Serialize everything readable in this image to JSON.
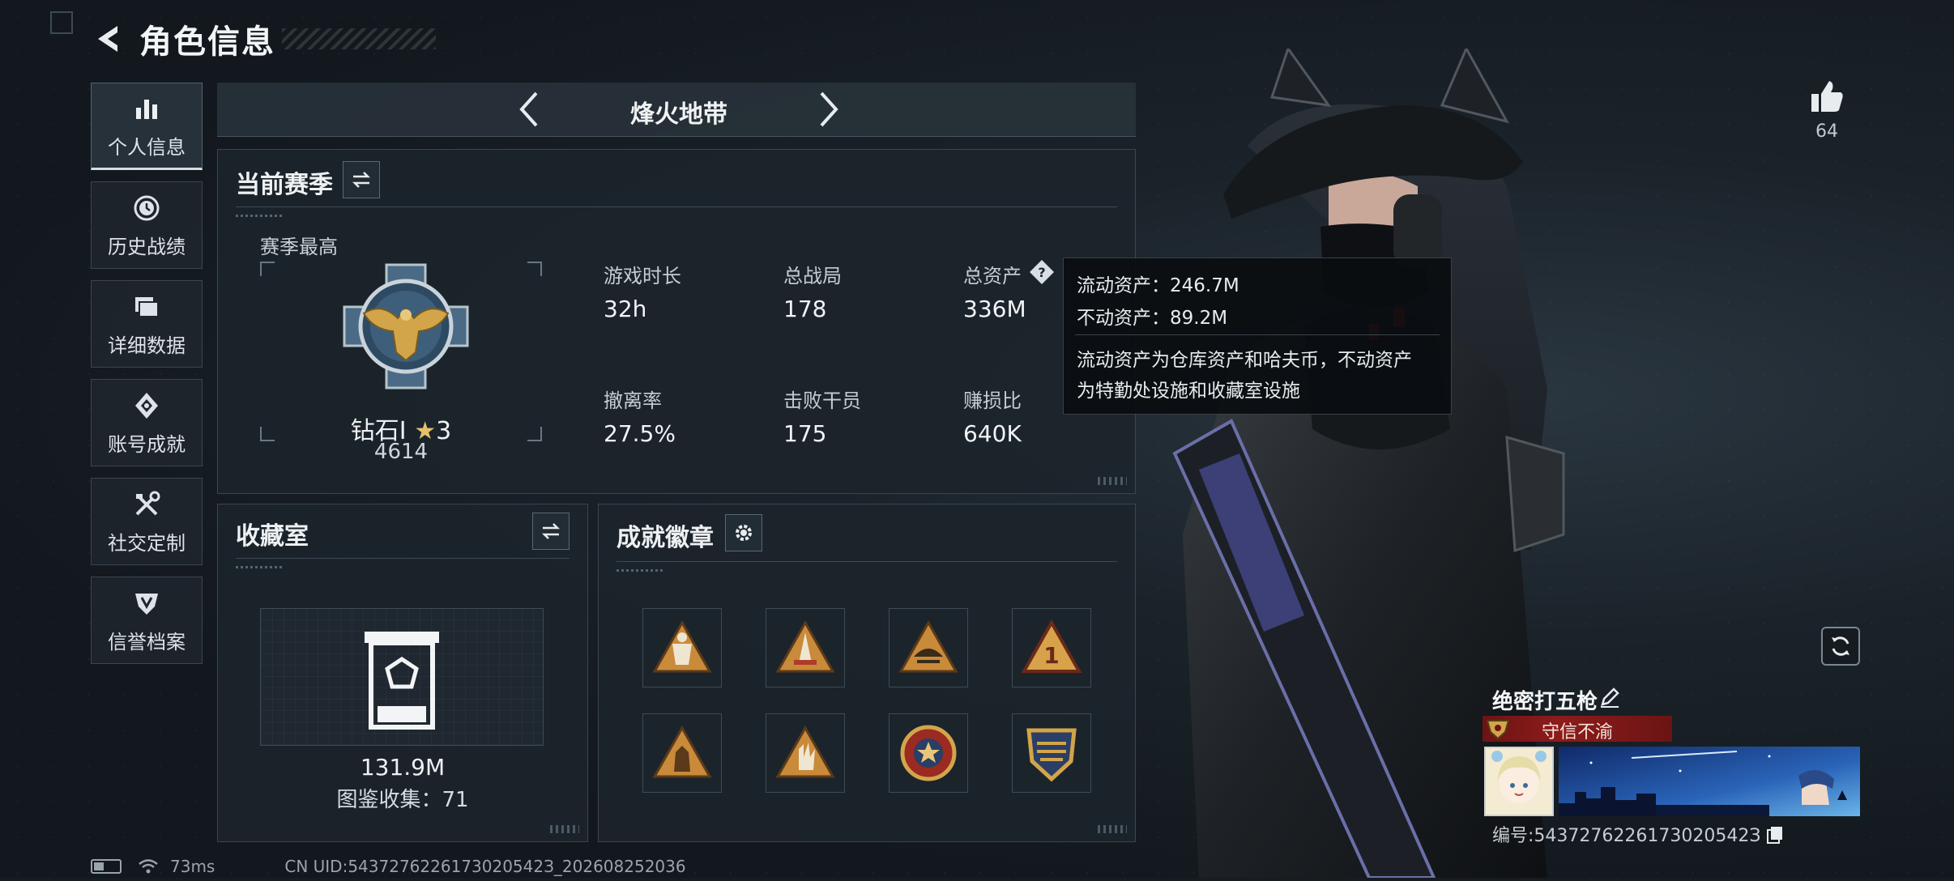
{
  "header": {
    "title": "角色信息"
  },
  "nav": [
    {
      "label": "个人信息",
      "icon": "bar-chart-icon",
      "active": true
    },
    {
      "label": "历史战绩",
      "icon": "history-clock-icon"
    },
    {
      "label": "详细数据",
      "icon": "folder-icon"
    },
    {
      "label": "账号成就",
      "icon": "achievement-gem-icon"
    },
    {
      "label": "社交定制",
      "icon": "tools-icon"
    },
    {
      "label": "信誉档案",
      "icon": "shield-icon"
    }
  ],
  "mode": {
    "title": "烽火地带"
  },
  "season": {
    "title": "当前赛季",
    "best_label": "赛季最高",
    "rank_name": "钻石Ⅰ",
    "rank_stars": "3",
    "rank_score": "4614",
    "stats": [
      {
        "label": "游戏时长",
        "value": "32h"
      },
      {
        "label": "总战局",
        "value": "178"
      },
      {
        "label": "总资产",
        "value": "336M"
      },
      {
        "label": "撤离率",
        "value": "27.5%"
      },
      {
        "label": "击败干员",
        "value": "175"
      },
      {
        "label": "赚损比",
        "value": "640K"
      }
    ]
  },
  "tooltip": {
    "liquid": "流动资产：246.7M",
    "fixed": "不动资产：89.2M",
    "desc_line1": "流动资产为仓库资产和哈夫币，不动资产",
    "desc_line2": "为特勤处设施和收藏室设施"
  },
  "collection": {
    "title": "收藏室",
    "value": "131.9M",
    "count": "图鉴收集：71"
  },
  "badges": {
    "title": "成就徽章",
    "items": [
      "achievement-badge-1",
      "achievement-badge-2",
      "achievement-badge-3",
      "achievement-badge-4",
      "achievement-badge-5",
      "achievement-badge-6",
      "achievement-badge-7",
      "achievement-badge-8"
    ]
  },
  "profile": {
    "likes": "64",
    "nickname": "绝密打五枪",
    "reputation": "守信不渝",
    "id_line": "编号:5437276226173020542З"
  },
  "status": {
    "ping": "73ms",
    "uid": "CN UID:5437276226173020542З_202608252036"
  },
  "colors": {
    "accent_red": "#8e1b1b",
    "badge_gold": "#d2a54a",
    "panel_bg": "#1c242b"
  }
}
